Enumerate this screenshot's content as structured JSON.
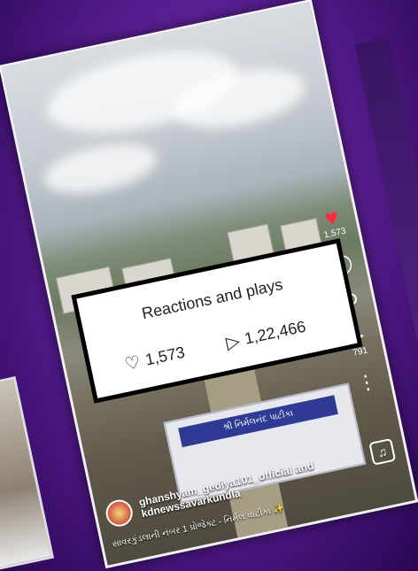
{
  "panel": {
    "title": "Reactions and plays",
    "likes": "1,573",
    "plays": "1,22,466"
  },
  "side": {
    "like_count": "1,573",
    "share_count": "791"
  },
  "caption": {
    "author": "ghanshyam_gediya101_official and kdnewssavarkundla",
    "subtitle": "સાવરકુંડલાની નંબર 1 પ્રોજેક્ટ - નિર્મલ વાટીકા ✨",
    "gate_sign": "શ્રી નિર્મલનંદ પાટીકા"
  },
  "icons": {
    "heart": "heart-icon",
    "comment": "comment-icon",
    "repost": "repost-icon",
    "share": "send-icon",
    "more": "more-icon",
    "music": "music-icon",
    "play": "play-icon"
  },
  "colors": {
    "background": "#5a1f93",
    "like_red": "#ff2a3a",
    "gate_sign": "#2e3a94"
  }
}
